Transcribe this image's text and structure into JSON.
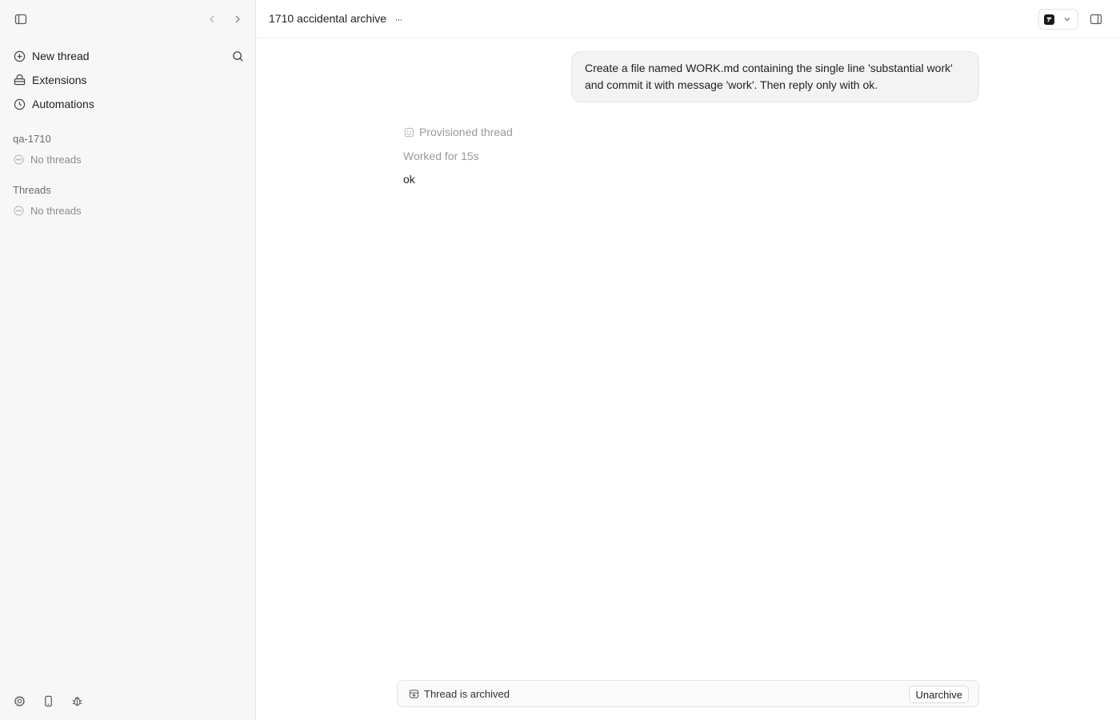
{
  "sidebar": {
    "nav": [
      {
        "label": "New thread",
        "icon": "plus-circle-icon"
      },
      {
        "label": "Extensions",
        "icon": "extensions-icon"
      },
      {
        "label": "Automations",
        "icon": "clock-icon"
      }
    ],
    "sections": [
      {
        "label": "qa-1710",
        "empty_text": "No threads"
      },
      {
        "label": "Threads",
        "empty_text": "No threads"
      }
    ],
    "footer_icons": [
      "gear-icon",
      "phone-icon",
      "bug-icon"
    ]
  },
  "header": {
    "title": "1710 accidental archive",
    "more_label": "···"
  },
  "conversation": {
    "user_message": "Create a file named WORK.md containing the single line 'substantial work' and commit it with message 'work'. Then reply only with ok.",
    "provisioned_label": "Provisioned thread",
    "worked_label": "Worked for 15s",
    "reply": "ok"
  },
  "archive_bar": {
    "text": "Thread is archived",
    "button_label": "Unarchive"
  },
  "colors": {
    "sidebar_bg": "#f7f7f7",
    "bubble_bg": "#f3f3f3",
    "muted_text": "#9a9a9a"
  }
}
